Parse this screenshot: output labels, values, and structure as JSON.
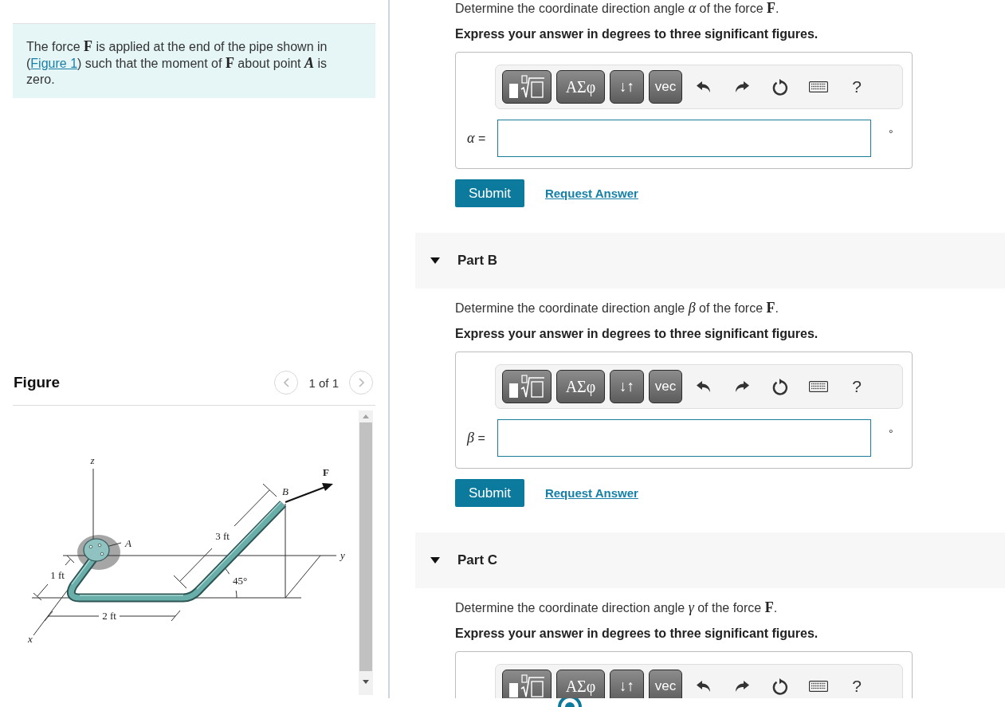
{
  "problem": {
    "text_before": "The force **F** is applied at the end of the pipe shown in (",
    "link": "Figure 1",
    "text_after": ") such that the moment of **F** about point *A* is zero."
  },
  "figure": {
    "title": "Figure",
    "pager": "1 of 1",
    "labels": [
      "z",
      "F",
      "B",
      "A",
      "3 ft",
      "y",
      "1 ft",
      "45°",
      "2 ft",
      "x"
    ]
  },
  "parts": [
    {
      "question": "Determine the coordinate direction angle *α* of the force **F**.",
      "instruction": "Express your answer in degrees to three significant figures.",
      "toolbar": [
        {
          "kind": "template"
        },
        {
          "kind": "greek",
          "label": "ΑΣφ"
        },
        {
          "kind": "arrows",
          "label": "↓↑"
        },
        {
          "kind": "vec",
          "label": "vec"
        },
        {
          "kind": "undo"
        },
        {
          "kind": "redo"
        },
        {
          "kind": "reset"
        },
        {
          "kind": "keyboard"
        },
        {
          "kind": "help",
          "label": "?"
        }
      ],
      "answer": {
        "variable": "*α* =",
        "unit": "°"
      },
      "submit": "Submit",
      "request": "Request Answer"
    },
    {
      "header": {
        "title": "Part B",
        "expanded": true
      },
      "question": "Determine the coordinate direction angle *β* of the force **F**.",
      "instruction": "Express your answer in degrees to three significant figures.",
      "toolbar": [
        {
          "kind": "template"
        },
        {
          "kind": "greek",
          "label": "ΑΣφ"
        },
        {
          "kind": "arrows",
          "label": "↓↑"
        },
        {
          "kind": "vec",
          "label": "vec"
        },
        {
          "kind": "undo"
        },
        {
          "kind": "redo"
        },
        {
          "kind": "reset"
        },
        {
          "kind": "keyboard"
        },
        {
          "kind": "help",
          "label": "?"
        }
      ],
      "answer": {
        "variable": "*β* =",
        "unit": "°"
      },
      "submit": "Submit",
      "request": "Request Answer"
    },
    {
      "header": {
        "title": "Part C",
        "expanded": true
      },
      "question": "Determine the coordinate direction angle *γ* of the force **F**.",
      "instruction": "Express your answer in degrees to three significant figures.",
      "toolbar": [
        {
          "kind": "template"
        },
        {
          "kind": "greek",
          "label": "ΑΣφ"
        },
        {
          "kind": "arrows",
          "label": "↓↑"
        },
        {
          "kind": "vec",
          "label": "vec"
        },
        {
          "kind": "undo"
        },
        {
          "kind": "redo"
        },
        {
          "kind": "reset"
        },
        {
          "kind": "keyboard"
        },
        {
          "kind": "help",
          "label": "?"
        }
      ]
    }
  ]
}
